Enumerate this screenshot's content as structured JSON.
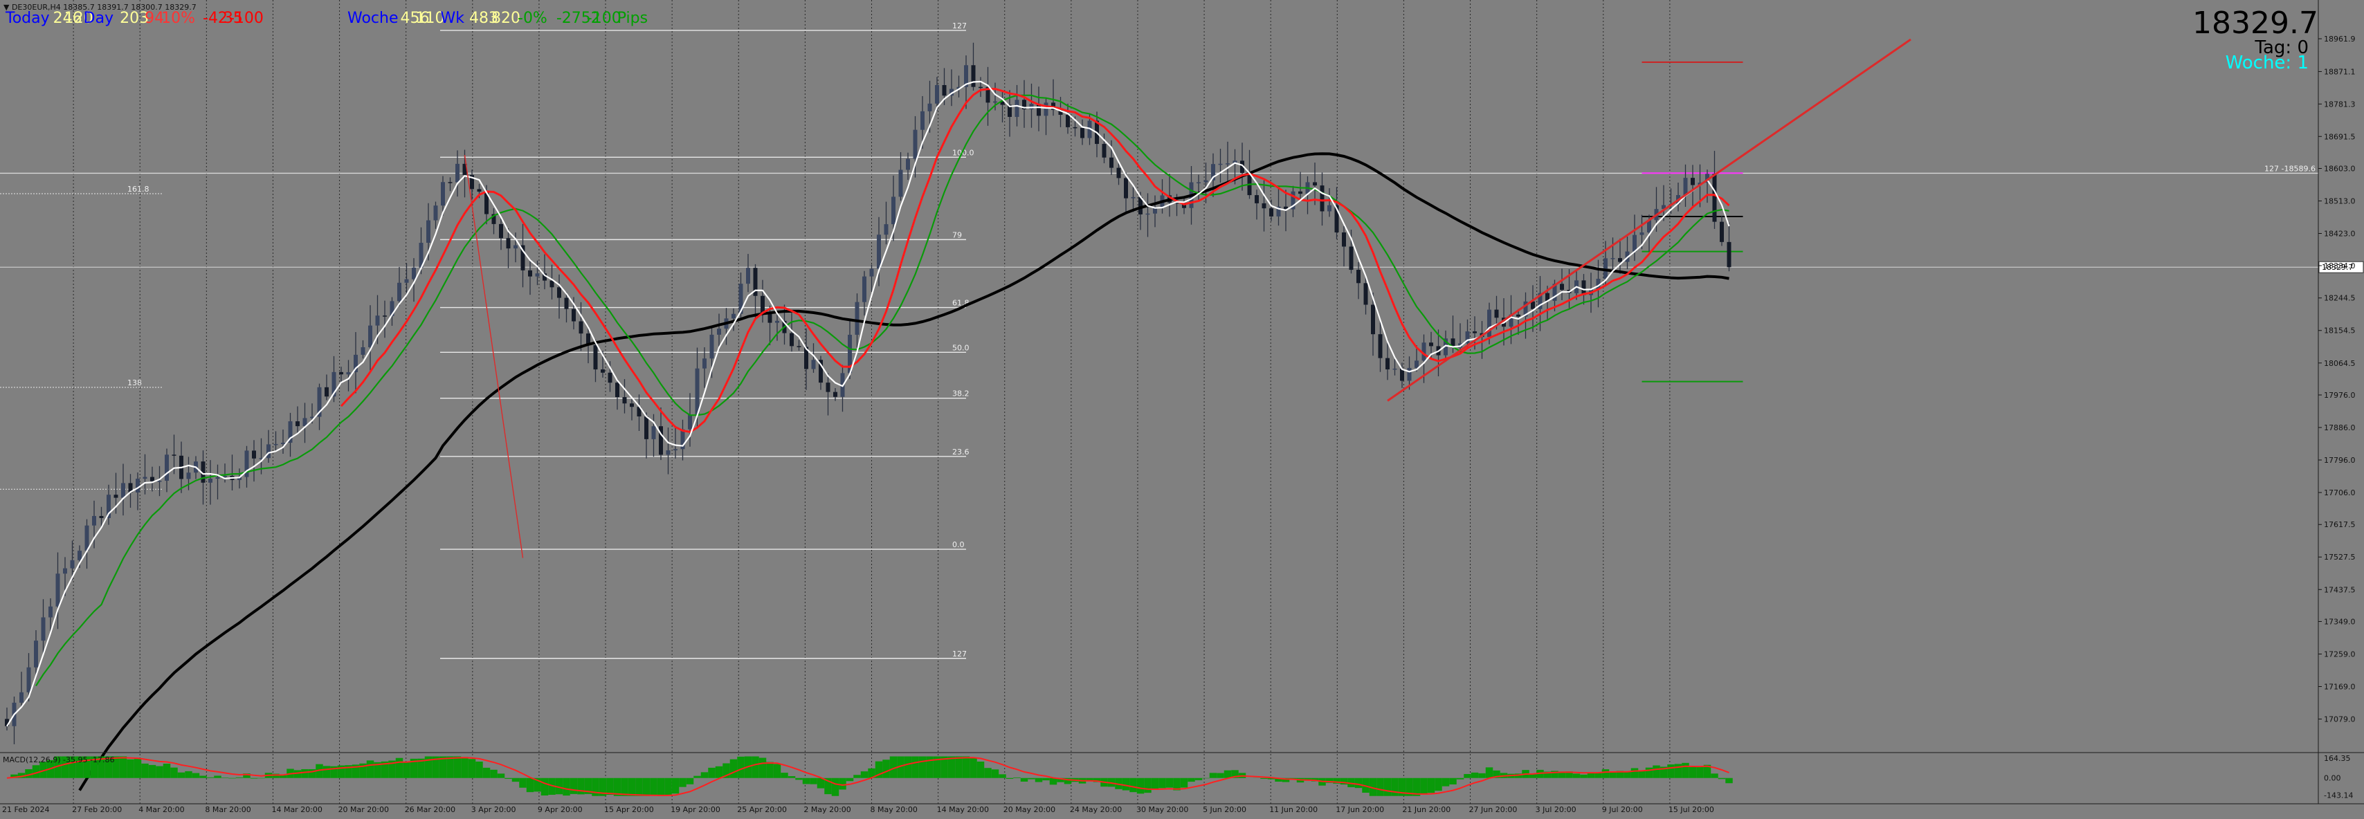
{
  "symbol_line": "▼ DE30EUR,H4  18385.7 18391.7 18300.7 18329.7",
  "stats": {
    "today_label": "Today",
    "today_values": [
      "246",
      "120",
      "Day",
      "203",
      "94",
      "10%",
      "-42",
      "35",
      "-100"
    ],
    "woche_label": "Woche",
    "woche_values": [
      "456",
      "110",
      "Wk",
      "483",
      "820",
      "-0%",
      "-2752",
      "-100",
      "Pips"
    ]
  },
  "info_panel": {
    "price": "18329.7",
    "tag_text": "Tag:  0",
    "woche_text": "Woche:  1"
  },
  "colors": {
    "background": "#808080",
    "candle": "#2a3140",
    "ma_fast": "#ffffff",
    "ma_mid": "#ff1a1a",
    "ma_green": "#0a9a0a",
    "ma_long": "#000000",
    "trendline": "#dd2a2a",
    "fib": "#e8e8e8",
    "info_price": "#000000",
    "info_woche": "#00ffff",
    "stats_today": "#0000ff",
    "stats_red": "#ff0000",
    "stats_yellow": "#ffff99",
    "stats_green": "#00a000"
  },
  "chart_data": {
    "type": "candlestick",
    "timeframe": "H4",
    "ylim": [
      16990,
      19050
    ],
    "price_ticks": [
      "18961.9",
      "18871.1",
      "18781.3",
      "18691.5",
      "18603.0",
      "18513.0",
      "18423.0",
      "18334.0",
      "18244.5",
      "18154.5",
      "18064.5",
      "17976.0",
      "17886.0",
      "17796.0",
      "17706.0",
      "17617.5",
      "17527.5",
      "17437.5",
      "17349.0",
      "17259.0",
      "17169.0",
      "17079.0"
    ],
    "current_price": 18329.7,
    "current_price_label": "18329.7",
    "hline": {
      "label": "127 -18589.6",
      "y": 18589.6
    },
    "time_labels": [
      "21 Feb 2024",
      "27 Feb 20:00",
      "4 Mar 20:00",
      "8 Mar 20:00",
      "14 Mar 20:00",
      "20 Mar 20:00",
      "26 Mar 20:00",
      "3 Apr 20:00",
      "9 Apr 20:00",
      "15 Apr 20:00",
      "19 Apr 20:00",
      "25 Apr 20:00",
      "2 May 20:00",
      "8 May 20:00",
      "14 May 20:00",
      "20 May 20:00",
      "24 May 20:00",
      "30 May 20:00",
      "5 Jun 20:00",
      "11 Jun 20:00",
      "17 Jun 20:00",
      "21 Jun 20:00",
      "27 Jun 20:00",
      "3 Jul 20:00",
      "9 Jul 20:00",
      "15 Jul 20:00"
    ],
    "bar_count": 238,
    "price_keypoints": [
      [
        0,
        17060
      ],
      [
        6,
        17420
      ],
      [
        14,
        17700
      ],
      [
        22,
        17780
      ],
      [
        30,
        17740
      ],
      [
        40,
        17900
      ],
      [
        48,
        18080
      ],
      [
        56,
        18360
      ],
      [
        62,
        18620
      ],
      [
        66,
        18480
      ],
      [
        72,
        18320
      ],
      [
        80,
        18110
      ],
      [
        88,
        17870
      ],
      [
        92,
        17820
      ],
      [
        96,
        18080
      ],
      [
        102,
        18300
      ],
      [
        108,
        18100
      ],
      [
        114,
        18000
      ],
      [
        120,
        18420
      ],
      [
        126,
        18780
      ],
      [
        132,
        18880
      ],
      [
        136,
        18790
      ],
      [
        144,
        18750
      ],
      [
        150,
        18700
      ],
      [
        156,
        18480
      ],
      [
        162,
        18520
      ],
      [
        168,
        18620
      ],
      [
        174,
        18450
      ],
      [
        180,
        18560
      ],
      [
        185,
        18330
      ],
      [
        190,
        18020
      ],
      [
        196,
        18100
      ],
      [
        204,
        18180
      ],
      [
        212,
        18250
      ],
      [
        218,
        18280
      ],
      [
        224,
        18420
      ],
      [
        230,
        18560
      ],
      [
        234,
        18560
      ],
      [
        237,
        18329
      ]
    ],
    "fib_levels": [
      {
        "label": "127",
        "y": 18985
      },
      {
        "label": "100.0",
        "y": 18634
      },
      {
        "label": "79",
        "y": 18406
      },
      {
        "label": "61.8",
        "y": 18218
      },
      {
        "label": "50.0",
        "y": 18094
      },
      {
        "label": "38.2",
        "y": 17967
      },
      {
        "label": "23.6",
        "y": 17806
      },
      {
        "label": "0.0",
        "y": 17549
      },
      {
        "label": "127",
        "y": 17247
      }
    ],
    "left_fib_marks": [
      {
        "label": "161.8",
        "y": 18533
      },
      {
        "label": "138",
        "y": 17997
      },
      {
        "label": "",
        "y": 17715
      }
    ],
    "trend_line_bars": [
      190,
      262
    ],
    "trend_line_prices": [
      17960,
      18960
    ],
    "fib_swing_line": {
      "from_bar": 63,
      "to_bar": 71,
      "from_price": 18640,
      "to_price": 17525
    },
    "pivot_levels": [
      {
        "y": 18897,
        "color": "#cc2222"
      },
      {
        "y": 18590,
        "color": "#ff33ff"
      },
      {
        "y": 18470,
        "color": "#000000"
      },
      {
        "y": 18373,
        "color": "#0a9a0a"
      },
      {
        "y": 18013,
        "color": "#0a9a0a"
      }
    ],
    "macd": {
      "label": "MACD(12,26,9) -35.95 -17.86",
      "ticks": [
        "164.35",
        "0.00",
        "-143.14"
      ],
      "ylim": [
        -180,
        200
      ]
    }
  }
}
